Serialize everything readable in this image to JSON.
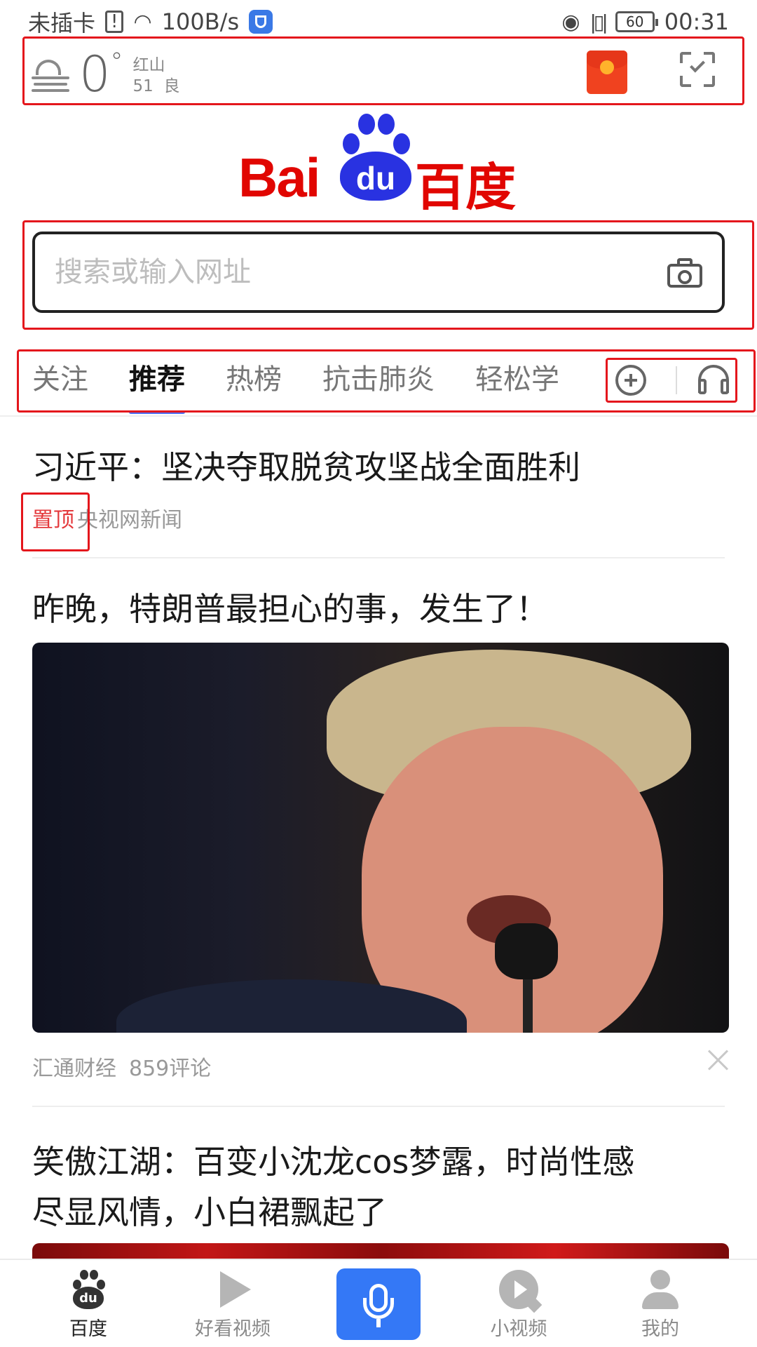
{
  "status_bar": {
    "carrier": "未插卡",
    "speed": "100B/s",
    "battery": "60",
    "time": "00:31"
  },
  "weather": {
    "icon": "haze-icon",
    "temperature": "0",
    "degree": "°",
    "location": "红山",
    "aqi_value": "51",
    "aqi_label": "良"
  },
  "logo": {
    "latin": "Bai",
    "paw_text": "du",
    "chinese": "百度"
  },
  "search": {
    "placeholder": "搜索或输入网址",
    "icon": "camera-icon"
  },
  "tabs": [
    {
      "label": "关注",
      "active": false
    },
    {
      "label": "推荐",
      "active": true
    },
    {
      "label": "热榜",
      "active": false
    },
    {
      "label": "抗击肺炎",
      "active": false
    },
    {
      "label": "轻松学",
      "active": false
    }
  ],
  "feed": [
    {
      "title": "习近平：坚决夺取脱贫攻坚战全面胜利",
      "pin_label": "置顶",
      "source": "央视网新闻"
    },
    {
      "title": "昨晚，特朗普最担心的事，发生了！",
      "source": "汇通财经",
      "comments": "859评论"
    },
    {
      "title_line1": "笑傲江湖：百变小沈龙cos梦露，时尚性感",
      "title_line2": "尽显风情，小白裙飘起了"
    }
  ],
  "bottom_nav": [
    {
      "label": "百度",
      "icon": "baidu-paw-icon",
      "active": true
    },
    {
      "label": "好看视频",
      "icon": "play-icon",
      "active": false
    },
    {
      "label": "",
      "icon": "microphone-icon",
      "active": false
    },
    {
      "label": "小视频",
      "icon": "small-video-icon",
      "active": false
    },
    {
      "label": "我的",
      "icon": "user-icon",
      "active": false
    }
  ],
  "colors": {
    "brand_red": "#e10601",
    "brand_blue": "#2932e1",
    "voice_blue": "#3478f6",
    "annotation_red": "#e4161c",
    "pin_red": "#e4393c",
    "tab_indicator": "#4e6ef2"
  }
}
